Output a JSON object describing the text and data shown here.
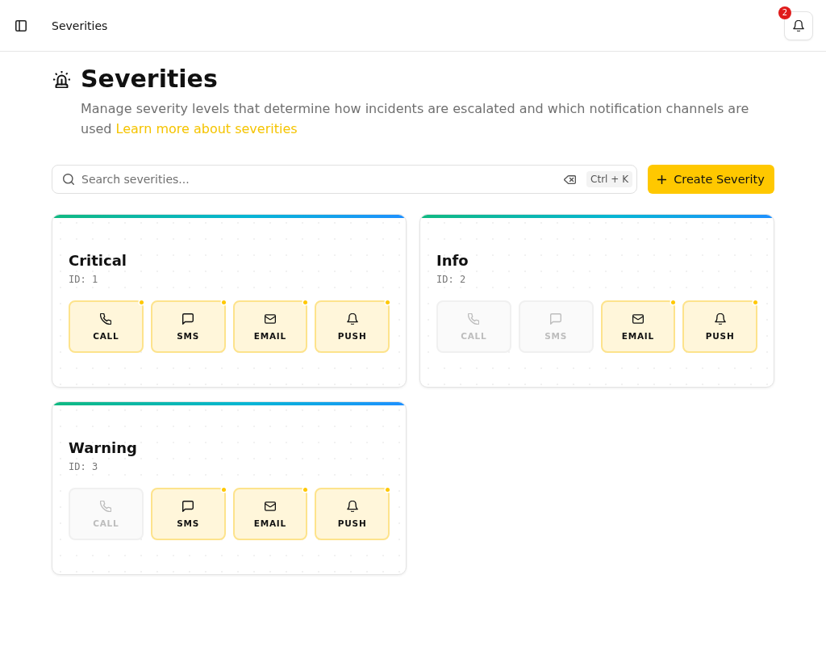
{
  "header": {
    "title": "Severities",
    "notification_count": "2"
  },
  "page": {
    "title": "Severities",
    "description": "Manage severity levels that determine how incidents are escalated and which notification channels are used",
    "link": "Learn more about severities"
  },
  "toolbar": {
    "search": {
      "placeholder": "Search severities...",
      "shortcut": "Ctrl + K"
    },
    "create_button": "Create Severity"
  },
  "severities": [
    {
      "name": "Critical",
      "id_label": "ID: 1",
      "channels": [
        {
          "kind": "call",
          "label": "CALL",
          "on": true
        },
        {
          "kind": "sms",
          "label": "SMS",
          "on": true
        },
        {
          "kind": "email",
          "label": "EMAIL",
          "on": true
        },
        {
          "kind": "push",
          "label": "PUSH",
          "on": true
        }
      ]
    },
    {
      "name": "Info",
      "id_label": "ID: 2",
      "channels": [
        {
          "kind": "call",
          "label": "CALL",
          "on": false
        },
        {
          "kind": "sms",
          "label": "SMS",
          "on": false
        },
        {
          "kind": "email",
          "label": "EMAIL",
          "on": true
        },
        {
          "kind": "push",
          "label": "PUSH",
          "on": true
        }
      ]
    },
    {
      "name": "Warning",
      "id_label": "ID: 3",
      "channels": [
        {
          "kind": "call",
          "label": "CALL",
          "on": false
        },
        {
          "kind": "sms",
          "label": "SMS",
          "on": true
        },
        {
          "kind": "email",
          "label": "EMAIL",
          "on": true
        },
        {
          "kind": "push",
          "label": "PUSH",
          "on": true
        }
      ]
    }
  ]
}
